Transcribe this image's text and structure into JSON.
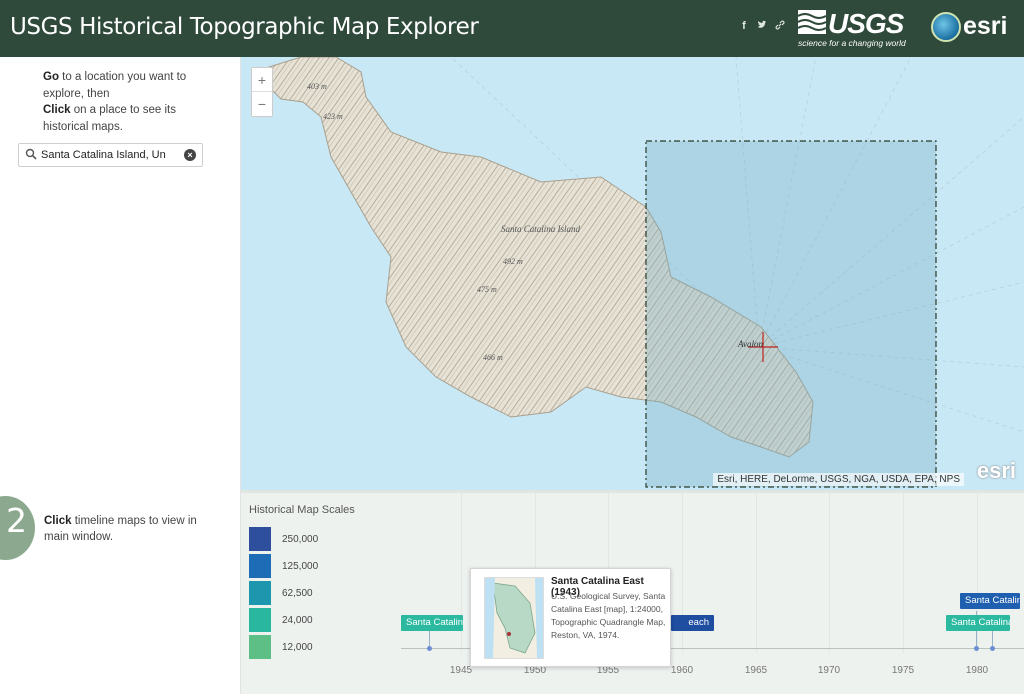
{
  "header": {
    "title": "USGS Historical Topographic Map Explorer",
    "social_icons": [
      "facebook-icon",
      "twitter-icon",
      "link-icon"
    ],
    "usgs_logo": {
      "word": "USGS",
      "tagline": "science for a changing world"
    },
    "esri_logo": {
      "word": "esri"
    }
  },
  "left_panel": {
    "step1": {
      "go_bold": "Go",
      "go_rest": " to a location you want to explore, then",
      "click_bold": "Click",
      "click_rest": " on a place to see its historical maps."
    },
    "search": {
      "value": "Santa Catalina Island, Un",
      "clear_icon": "close-circle-icon"
    },
    "step2": {
      "number": "2",
      "click_bold": "Click",
      "click_rest": " timeline maps to view in main window."
    }
  },
  "map": {
    "zoom_in": "+",
    "zoom_out": "−",
    "labels": {
      "elev_403": "403 m",
      "elev_423": "423 m",
      "island": "Santa Catalina Island",
      "elev_492": "492 m",
      "elev_475": "475 m",
      "elev_466": "466 m",
      "town": "Avalon"
    },
    "attribution": "Esri, HERE, DeLorme, USGS, NGA, USDA, EPA, NPS",
    "watermark": "esri"
  },
  "timeline": {
    "legend_title": "Historical Map Scales",
    "scales": [
      {
        "label": "250,000",
        "color": "#2d4f9e"
      },
      {
        "label": "125,000",
        "color": "#1e6cb5"
      },
      {
        "label": "62,500",
        "color": "#1d96ae"
      },
      {
        "label": "24,000",
        "color": "#29b89f"
      },
      {
        "label": "12,000",
        "color": "#5dbf85"
      }
    ],
    "years": [
      "1945",
      "1950",
      "1955",
      "1960",
      "1965",
      "1970",
      "1975",
      "1980"
    ],
    "items": [
      {
        "label": "Santa Catalina I",
        "scale": "24,000"
      },
      {
        "label": "each",
        "scale": "62,500"
      },
      {
        "label": "Santa Catalina",
        "scale": "62,500"
      },
      {
        "label": "Santa Catalina I",
        "scale": "24,000"
      }
    ],
    "popup": {
      "title": "Santa Catalina East (1943)",
      "body": "U.S. Geological Survey, Santa Catalina East [map], 1:24000, Topographic Quadrangle Map, Reston, VA, 1974."
    }
  }
}
